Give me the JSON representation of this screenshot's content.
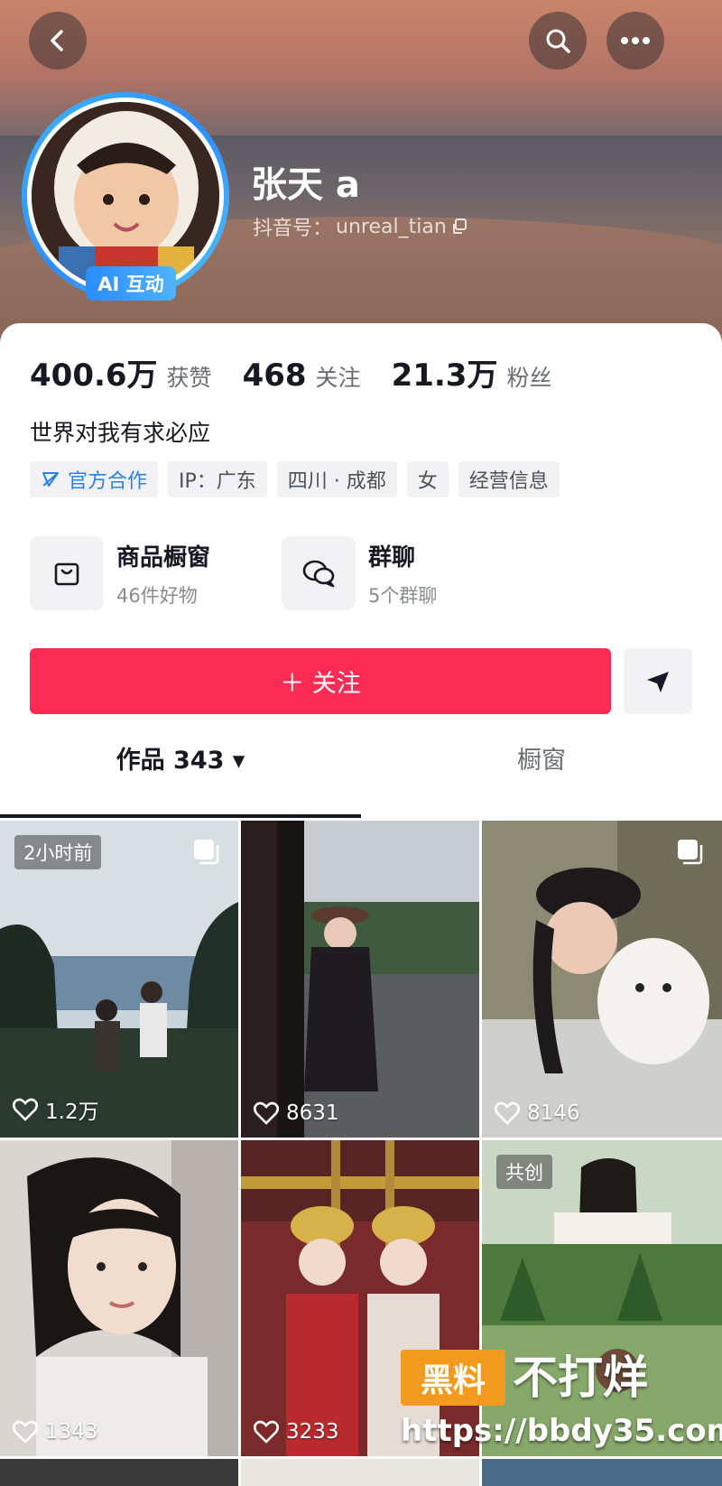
{
  "profile": {
    "nickname": "张天 a",
    "account_label": "抖音号：",
    "account_id": "unreal_tian",
    "ai_badge": "AI 互动",
    "bio": "世界对我有求必应"
  },
  "stats": [
    {
      "value": "400.6万",
      "label": "获赞"
    },
    {
      "value": "468",
      "label": "关注"
    },
    {
      "value": "21.3万",
      "label": "粉丝"
    }
  ],
  "tags": [
    "官方合作",
    "IP：广东",
    "四川 · 成都",
    "女",
    "经营信息"
  ],
  "quick_links": {
    "shop": {
      "title": "商品橱窗",
      "sub": "46件好物"
    },
    "group": {
      "title": "群聊",
      "sub": "5个群聊"
    }
  },
  "follow_label": "＋ 关注",
  "tabs": {
    "works": "作品 343 ▾",
    "window": "橱窗"
  },
  "posts": [
    {
      "likes": "1.2万",
      "badge": "2小时前"
    },
    {
      "likes": "8631"
    },
    {
      "likes": "8146"
    },
    {
      "likes": "1343"
    },
    {
      "likes": "3233"
    },
    {
      "likes": "",
      "badge": "共创"
    }
  ],
  "watermark": {
    "box": "黑料",
    "text": "不打烊",
    "url": "https://bbdy35.com"
  },
  "colors": {
    "follow": "#fe2c55",
    "official": "#2a82e4",
    "ai_badge": "#2b8cff"
  }
}
